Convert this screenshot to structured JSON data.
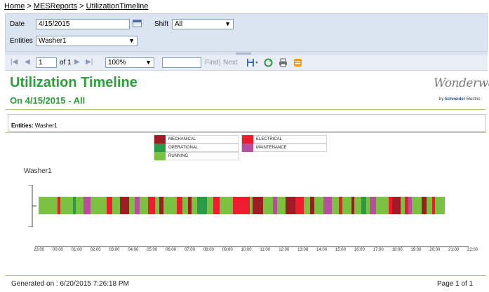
{
  "breadcrumb": {
    "home": "Home",
    "sep1": ">",
    "reports": "MESReports",
    "sep2": ">",
    "current": "UtilizationTimeline"
  },
  "params": {
    "date_label": "Date",
    "date_value": "4/15/2015",
    "shift_label": "Shift",
    "shift_value": "All",
    "entities_label": "Entities",
    "entities_value": "Washer1"
  },
  "toolbar": {
    "page_value": "1",
    "page_of": "of 1",
    "zoom_value": "100%",
    "find_label": "Find",
    "find_sep": "|",
    "next_label": "Next"
  },
  "report": {
    "title": "Utilization Timeline",
    "subtitle": "On 4/15/2015 - All",
    "entities_label": "Entities:",
    "entities_value": "Washer1",
    "logo_text": "Wonderware",
    "logo_byline_prefix": "by",
    "logo_byline_brand": "Schneider",
    "logo_byline_suffix": "Electric"
  },
  "legend": [
    {
      "label": "MECHANICAL",
      "color": "#a01c24"
    },
    {
      "label": "ELECTRICAL",
      "color": "#ee1c2e"
    },
    {
      "label": "OPERATIONAL",
      "color": "#2b9a48"
    },
    {
      "label": "MAINTENANCE",
      "color": "#b94ea0"
    },
    {
      "label": "RUNNING",
      "color": "#7bc142"
    }
  ],
  "chart_data": {
    "type": "timeline",
    "entity": "Washer1",
    "x_ticks": [
      "23:00",
      "00:00",
      "01:00",
      "02:00",
      "03:00",
      "04:00",
      "05:00",
      "06:00",
      "07:00",
      "08:00",
      "09:00",
      "10:00",
      "11:00",
      "12:00",
      "13:00",
      "14:00",
      "15:00",
      "16:00",
      "17:00",
      "18:00",
      "19:00",
      "20:00",
      "21:00",
      "22:00"
    ],
    "x_range": [
      23.0,
      46.0
    ],
    "start": 23.2,
    "end": 44.7,
    "segments": [
      [
        "RUNNING",
        23.2,
        24.2
      ],
      [
        "ELECTRICAL",
        24.2,
        24.35
      ],
      [
        "RUNNING",
        24.35,
        25.0
      ],
      [
        "OPERATIONAL",
        25.0,
        25.15
      ],
      [
        "RUNNING",
        25.15,
        25.55
      ],
      [
        "MAINTENANCE",
        25.55,
        25.95
      ],
      [
        "RUNNING",
        25.95,
        26.8
      ],
      [
        "ELECTRICAL",
        26.8,
        27.1
      ],
      [
        "RUNNING",
        27.1,
        27.5
      ],
      [
        "MECHANICAL",
        27.5,
        28.0
      ],
      [
        "RUNNING",
        28.0,
        28.3
      ],
      [
        "MAINTENANCE",
        28.3,
        28.55
      ],
      [
        "RUNNING",
        28.55,
        29.0
      ],
      [
        "ELECTRICAL",
        29.0,
        29.35
      ],
      [
        "RUNNING",
        29.35,
        29.6
      ],
      [
        "MECHANICAL",
        29.6,
        29.8
      ],
      [
        "RUNNING",
        29.8,
        30.5
      ],
      [
        "ELECTRICAL",
        30.5,
        30.8
      ],
      [
        "RUNNING",
        30.8,
        31.1
      ],
      [
        "MECHANICAL",
        31.1,
        31.3
      ],
      [
        "RUNNING",
        31.3,
        31.6
      ],
      [
        "OPERATIONAL",
        31.6,
        32.1
      ],
      [
        "RUNNING",
        32.1,
        32.45
      ],
      [
        "ELECTRICAL",
        32.45,
        32.8
      ],
      [
        "RUNNING",
        32.8,
        33.5
      ],
      [
        "ELECTRICAL",
        33.5,
        34.4
      ],
      [
        "RUNNING",
        34.4,
        34.55
      ],
      [
        "MECHANICAL",
        34.55,
        35.1
      ],
      [
        "RUNNING",
        35.1,
        35.6
      ],
      [
        "MAINTENANCE",
        35.6,
        35.85
      ],
      [
        "RUNNING",
        35.85,
        36.3
      ],
      [
        "MECHANICAL",
        36.3,
        36.8
      ],
      [
        "ELECTRICAL",
        36.8,
        37.25
      ],
      [
        "RUNNING",
        37.25,
        37.6
      ],
      [
        "MECHANICAL",
        37.6,
        37.8
      ],
      [
        "RUNNING",
        37.8,
        38.3
      ],
      [
        "MAINTENANCE",
        38.3,
        38.75
      ],
      [
        "RUNNING",
        38.75,
        39.1
      ],
      [
        "ELECTRICAL",
        39.1,
        39.3
      ],
      [
        "RUNNING",
        39.3,
        39.8
      ],
      [
        "MECHANICAL",
        39.8,
        39.95
      ],
      [
        "RUNNING",
        39.95,
        40.3
      ],
      [
        "OPERATIONAL",
        40.3,
        40.55
      ],
      [
        "RUNNING",
        40.55,
        40.75
      ],
      [
        "MAINTENANCE",
        40.75,
        41.1
      ],
      [
        "RUNNING",
        41.1,
        41.75
      ],
      [
        "ELECTRICAL",
        41.75,
        41.95
      ],
      [
        "MECHANICAL",
        41.95,
        42.4
      ],
      [
        "RUNNING",
        42.4,
        42.6
      ],
      [
        "ELECTRICAL",
        42.6,
        42.8
      ],
      [
        "MAINTENANCE",
        42.8,
        43.0
      ],
      [
        "RUNNING",
        43.0,
        43.5
      ],
      [
        "MECHANICAL",
        43.5,
        43.75
      ],
      [
        "RUNNING",
        43.75,
        44.05
      ],
      [
        "ELECTRICAL",
        44.05,
        44.2
      ],
      [
        "RUNNING",
        44.2,
        44.7
      ]
    ]
  },
  "footer": {
    "generated": "Generated on : 6/20/2015 7:26:18 PM",
    "page": "Page 1 of 1"
  }
}
